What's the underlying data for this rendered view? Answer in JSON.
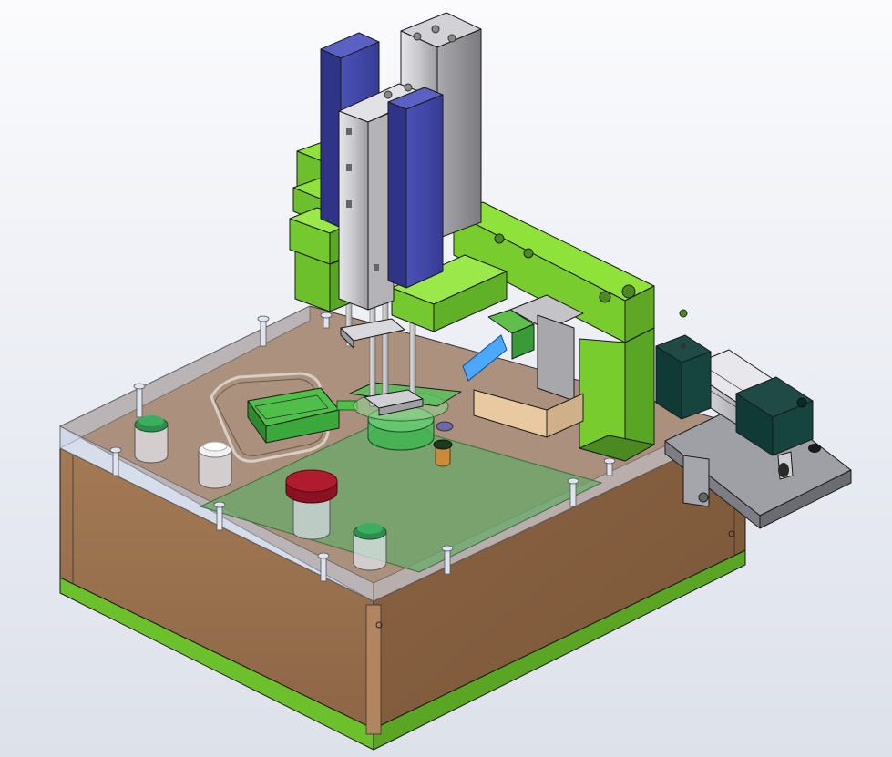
{
  "scene": {
    "kind": "3d-cad-assembly-view",
    "colors": {
      "background_top": "#fbfbfd",
      "background_bottom": "#dde1ea",
      "cabinet_wood": "#9a7050",
      "base_trim_green": "#6cc02c",
      "frame_green": "#7ed321",
      "cylinder_blue": "#3f45a6",
      "cylinder_silver": "#c8c8cc",
      "emergency_stop_red": "#a8182a",
      "button_dark_green": "#1f6b3a",
      "actuator_dark_teal": "#0f3a36",
      "highlight_blue": "#4aa8ff"
    },
    "icons": [
      "emergency-stop-button",
      "start-button-green-left",
      "start-button-green-right",
      "reset-button-white",
      "pneumatic-cylinder",
      "vertical-slide-cylinder",
      "gripper-cylinder"
    ]
  }
}
